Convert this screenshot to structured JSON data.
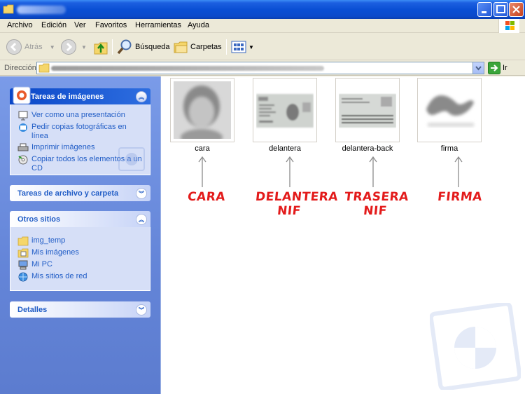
{
  "menu": [
    "Archivo",
    "Edición",
    "Ver",
    "Favoritos",
    "Herramientas",
    "Ayuda"
  ],
  "toolbar": {
    "back_label": "Atrás",
    "search_label": "Búsqueda",
    "folders_label": "Carpetas"
  },
  "address": {
    "label": "Dirección",
    "go_label": "Ir"
  },
  "sidebar": {
    "image_tasks": {
      "title": "Tareas de imágenes",
      "items": [
        "Ver como una presentación",
        "Pedir copias fotográficas en línea",
        "Imprimir imágenes",
        "Copiar todos los elementos a un CD"
      ]
    },
    "file_tasks": {
      "title": "Tareas de archivo y carpeta"
    },
    "other_places": {
      "title": "Otros sitios",
      "items": [
        "img_temp",
        "Mis imágenes",
        "Mi PC",
        "Mis sitios de red"
      ]
    },
    "details": {
      "title": "Detalles"
    }
  },
  "files": [
    {
      "name": "cara",
      "annotation": "CARA"
    },
    {
      "name": "delantera",
      "annotation": "DELANTERA NIF"
    },
    {
      "name": "delantera-back",
      "annotation": "TRASERA NIF"
    },
    {
      "name": "firma",
      "annotation": "FIRMA"
    }
  ],
  "colors": {
    "annotation": "#e31b1b",
    "link": "#215dc6",
    "sidebar": "#6485d8",
    "titlebar": "#0a4fd4"
  }
}
